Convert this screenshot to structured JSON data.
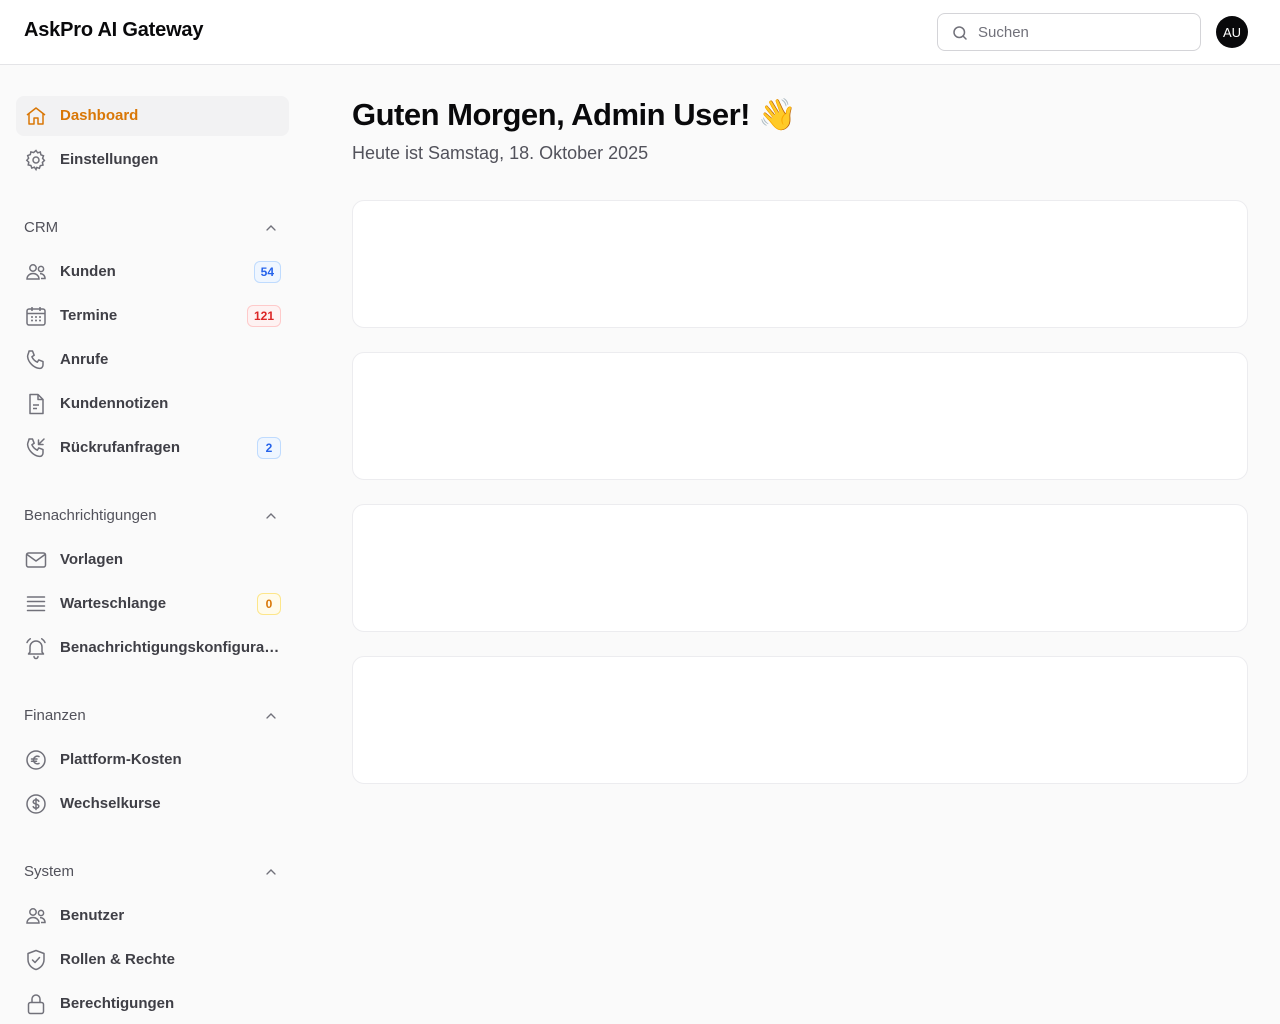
{
  "header": {
    "brand": "AskPro AI Gateway",
    "search_placeholder": "Suchen",
    "avatar_initials": "AU"
  },
  "sidebar": {
    "top_items": [
      {
        "label": "Dashboard",
        "icon": "home-icon",
        "active": true
      },
      {
        "label": "Einstellungen",
        "icon": "gear-icon"
      }
    ],
    "groups": [
      {
        "title": "CRM",
        "items": [
          {
            "label": "Kunden",
            "icon": "users-icon",
            "badge": "54",
            "badge_color": "blue"
          },
          {
            "label": "Termine",
            "icon": "calendar-icon",
            "badge": "121",
            "badge_color": "red"
          },
          {
            "label": "Anrufe",
            "icon": "phone-icon"
          },
          {
            "label": "Kundennotizen",
            "icon": "document-icon"
          },
          {
            "label": "Rückrufanfragen",
            "icon": "phone-incoming-icon",
            "badge": "2",
            "badge_color": "blue"
          }
        ]
      },
      {
        "title": "Benachrichtigungen",
        "items": [
          {
            "label": "Vorlagen",
            "icon": "envelope-icon"
          },
          {
            "label": "Warteschlange",
            "icon": "queue-icon",
            "badge": "0",
            "badge_color": "amber"
          },
          {
            "label": "Benachrichtigungskonfiguratio...",
            "icon": "bell-icon"
          }
        ]
      },
      {
        "title": "Finanzen",
        "items": [
          {
            "label": "Plattform-Kosten",
            "icon": "euro-icon"
          },
          {
            "label": "Wechselkurse",
            "icon": "dollar-icon"
          }
        ]
      },
      {
        "title": "System",
        "items": [
          {
            "label": "Benutzer",
            "icon": "users-icon"
          },
          {
            "label": "Rollen & Rechte",
            "icon": "shield-check-icon"
          },
          {
            "label": "Berechtigungen",
            "icon": "lock-icon"
          }
        ]
      }
    ]
  },
  "main": {
    "greeting": "Guten Morgen, Admin User! 👋",
    "date_line": "Heute ist Samstag, 18. Oktober 2025"
  },
  "colors": {
    "accent": "#d97706",
    "badge_blue": "#2563eb",
    "badge_red": "#dc2626",
    "badge_amber": "#d97706"
  }
}
